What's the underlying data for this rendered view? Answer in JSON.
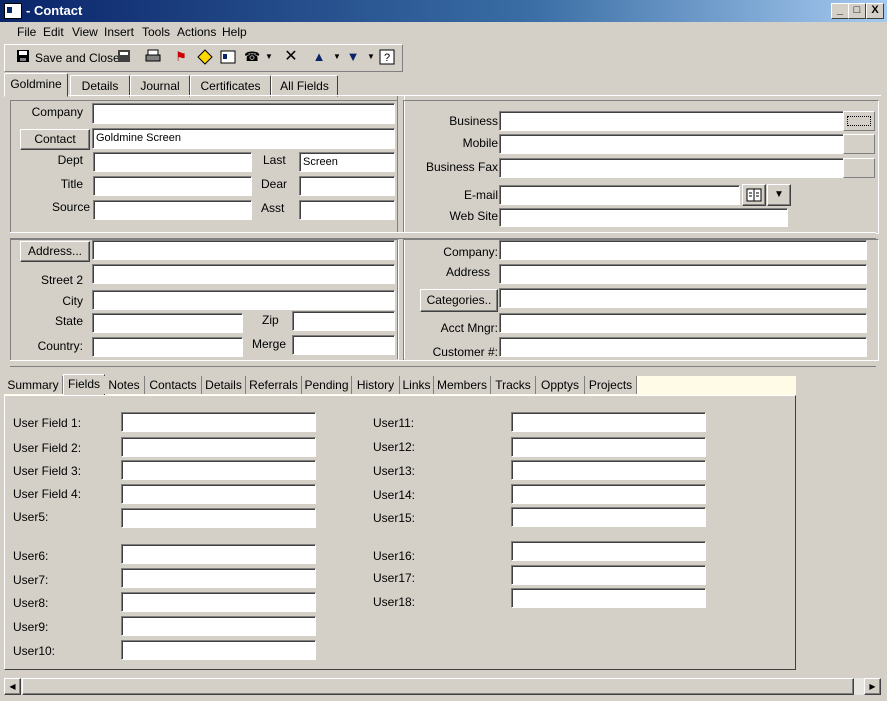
{
  "window": {
    "title": "- Contact",
    "min": "_",
    "max": "□",
    "close": "X"
  },
  "menu": [
    "File",
    "Edit",
    "View",
    "Insert",
    "Tools",
    "Actions",
    "Help"
  ],
  "toolbar": {
    "save_close": "Save and Close"
  },
  "top_tabs": [
    "Goldmine",
    "Details",
    "Journal",
    "Certificates",
    "All Fields"
  ],
  "contact": {
    "company_label": "Company",
    "company_value": "",
    "contact_button": "Contact",
    "contact_value": "Goldmine Screen",
    "dept_label": "Dept",
    "last_label": "Last",
    "last_value": "Screen",
    "title_label": "Title",
    "dear_label": "Dear",
    "source_label": "Source",
    "asst_label": "Asst"
  },
  "phones": {
    "business_label": "Business",
    "mobile_label": "Mobile",
    "business_fax_label": "Business Fax",
    "email_label": "E-mail",
    "website_label": "Web Site"
  },
  "address": {
    "address_button": "Address...",
    "street2_label": "Street 2",
    "city_label": "City",
    "state_label": "State",
    "zip_label": "Zip",
    "country_label": "Country:",
    "merge_label": "Merge"
  },
  "org": {
    "company_label": "Company:",
    "address_label": "Address",
    "categories_button": "Categories..",
    "acct_mngr_label": "Acct Mngr:",
    "customer_label": "Customer #:"
  },
  "bottom_tabs": [
    "Summary",
    "Fields",
    "Notes",
    "Contacts",
    "Details",
    "Referrals",
    "Pending",
    "History",
    "Links",
    "Members",
    "Tracks",
    "Opptys",
    "Projects"
  ],
  "user_fields_left": [
    "User Field 1:",
    "User Field 2:",
    "User Field 3:",
    "User Field 4:",
    "User5:",
    "User6:",
    "User7:",
    "User8:",
    "User9:",
    "User10:"
  ],
  "user_fields_right": [
    "User11:",
    "User12:",
    "User13:",
    "User14:",
    "User15:",
    "User16:",
    "User17:",
    "User18:"
  ]
}
